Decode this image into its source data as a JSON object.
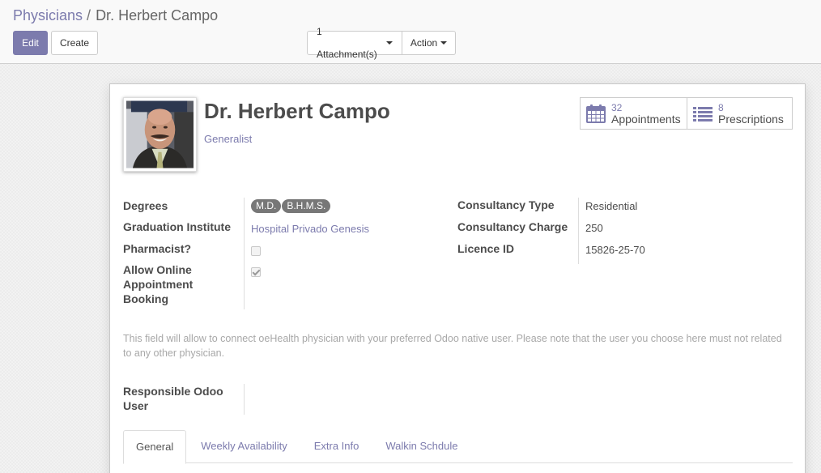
{
  "breadcrumb": {
    "parent": "Physicians",
    "separator": "/",
    "current": "Dr. Herbert Campo"
  },
  "toolbar": {
    "edit_label": "Edit",
    "create_label": "Create",
    "attachments_label": "1 Attachment(s)",
    "action_label": "Action"
  },
  "physician": {
    "name": "Dr. Herbert Campo",
    "specialty": "Generalist",
    "photo_icon": "physician-photo"
  },
  "smart_buttons": [
    {
      "icon": "calendar-icon",
      "count": "32",
      "label": "Appointments"
    },
    {
      "icon": "list-icon",
      "count": "8",
      "label": "Prescriptions"
    }
  ],
  "fields_left": {
    "degrees_label": "Degrees",
    "degrees": [
      "M.D.",
      "B.H.M.S."
    ],
    "graduation_label": "Graduation Institute",
    "graduation_value": "Hospital Privado Genesis",
    "pharmacist_label": "Pharmacist?",
    "pharmacist_checked": false,
    "online_booking_label": "Allow Online Appointment Booking",
    "online_booking_checked": true
  },
  "fields_right": {
    "consultancy_type_label": "Consultancy Type",
    "consultancy_type_value": "Residential",
    "consultancy_charge_label": "Consultancy Charge",
    "consultancy_charge_value": "250",
    "licence_label": "Licence ID",
    "licence_value": "15826-25-70"
  },
  "help_text": "This field will allow to connect oeHealth physician with your preferred Odoo native user. Please note that the user you choose here must not related to any other physician.",
  "responsible_user": {
    "label": "Responsible Odoo User",
    "value": ""
  },
  "tabs": [
    {
      "label": "General",
      "active": true
    },
    {
      "label": "Weekly Availability",
      "active": false
    },
    {
      "label": "Extra Info",
      "active": false
    },
    {
      "label": "Walkin Schdule",
      "active": false
    }
  ],
  "colors": {
    "brand": "#7c7bad",
    "tag_bg": "#777777",
    "text": "#4c4c4c"
  }
}
